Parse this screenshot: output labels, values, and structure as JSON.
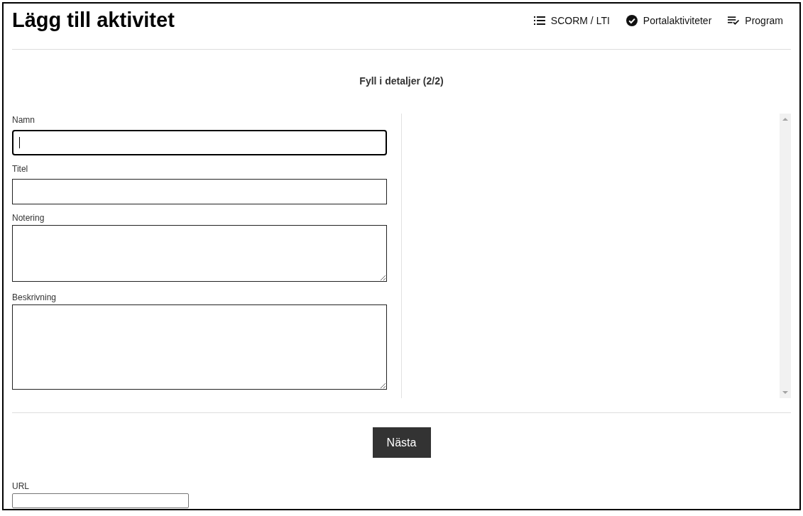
{
  "header": {
    "title": "Lägg till aktivitet",
    "nav": [
      {
        "kind": "list",
        "label": "SCORM / LTI"
      },
      {
        "kind": "check",
        "label": "Portalaktiviteter"
      },
      {
        "kind": "playlist",
        "label": "Program"
      }
    ]
  },
  "step_title": "Fyll i detaljer (2/2)",
  "fields": [
    {
      "kind": "input",
      "label": "Namn",
      "focused": true
    },
    {
      "kind": "input",
      "label": "Titel",
      "focused": false
    },
    {
      "kind": "textarea",
      "label": "Notering",
      "focused": false
    },
    {
      "kind": "textarea",
      "label": "Beskrivning",
      "focused": false
    }
  ],
  "next_button": "Nästa",
  "url_field": {
    "label": "URL"
  }
}
